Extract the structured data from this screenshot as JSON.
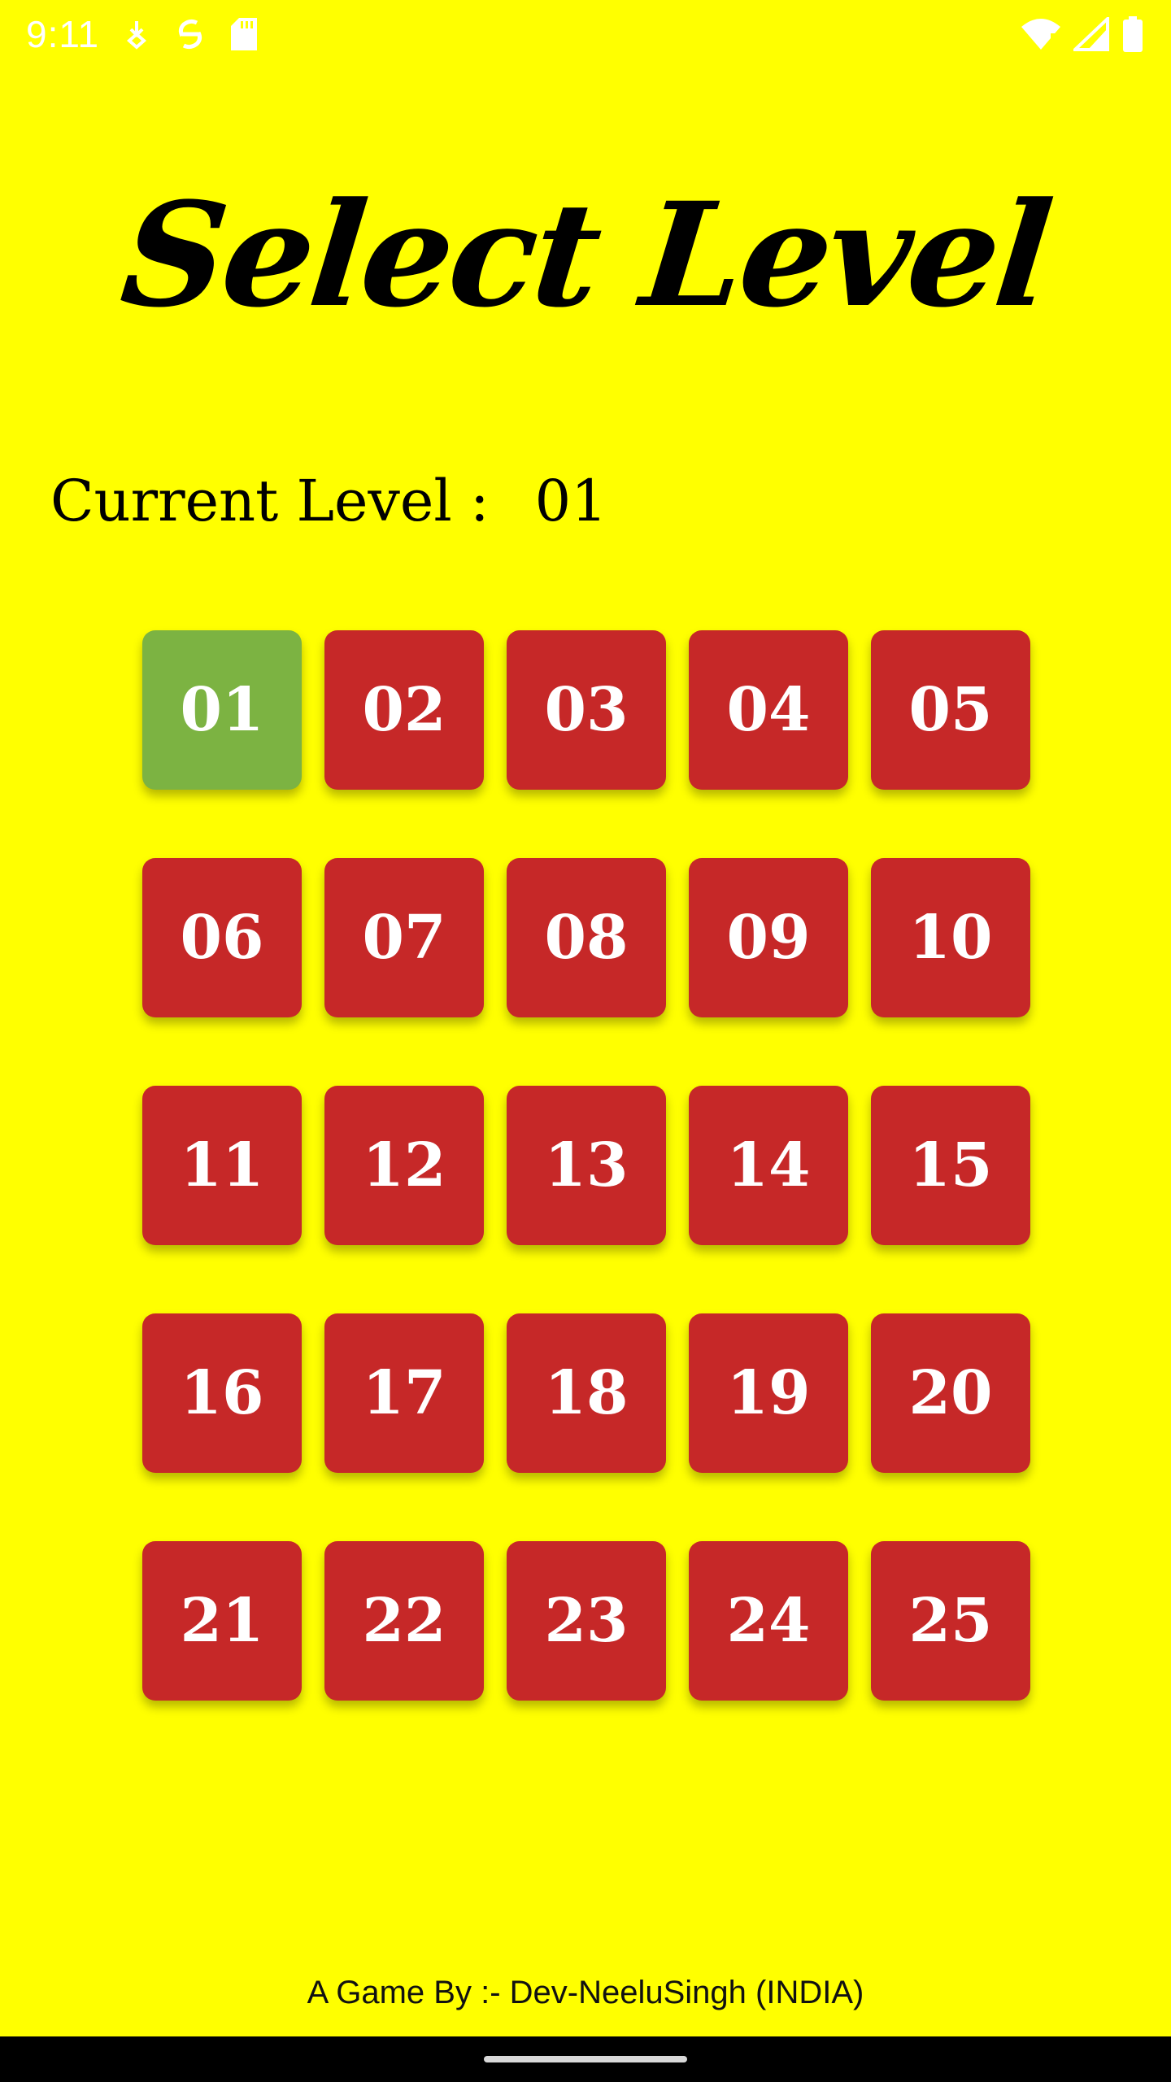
{
  "status_bar": {
    "time": "9:11",
    "left_icons": [
      "download-icon",
      "sync-icon",
      "sd-card-icon"
    ],
    "right_icons": [
      "wifi-icon",
      "signal-icon",
      "battery-icon"
    ]
  },
  "title": "Select Level",
  "current_level": {
    "label": "Current Level :",
    "value": "01"
  },
  "levels": [
    "01",
    "02",
    "03",
    "04",
    "05",
    "06",
    "07",
    "08",
    "09",
    "10",
    "11",
    "12",
    "13",
    "14",
    "15",
    "16",
    "17",
    "18",
    "19",
    "20",
    "21",
    "22",
    "23",
    "24",
    "25"
  ],
  "colors": {
    "background": "#FFFF00",
    "level_button": "#C62828",
    "current_level_button": "#7CB342"
  },
  "footer": "A Game By :- Dev-NeeluSingh (INDIA)"
}
